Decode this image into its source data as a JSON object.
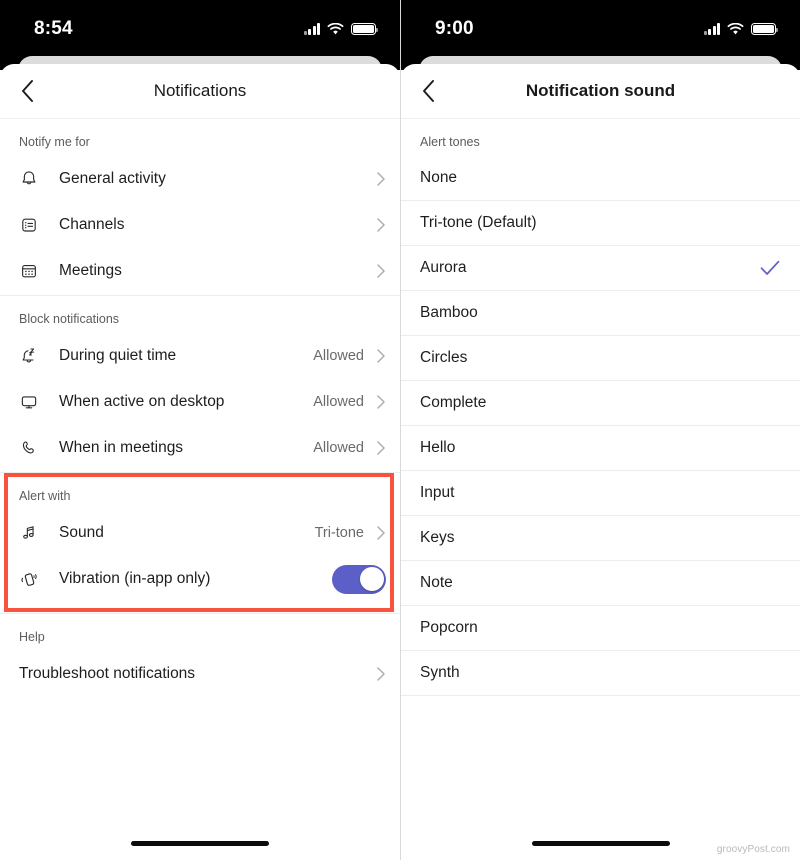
{
  "left": {
    "status": {
      "time": "8:54",
      "signal_icon": "cellular-signal-icon",
      "wifi_icon": "wifi-icon",
      "battery_icon": "battery-icon"
    },
    "nav": {
      "back_icon": "chevron-left-icon",
      "title": "Notifications"
    },
    "sections": [
      {
        "header": "Notify me for",
        "highlight": false,
        "rows": [
          {
            "icon": "bell-icon",
            "label": "General activity",
            "value": "",
            "control": "chevron"
          },
          {
            "icon": "channel-icon",
            "label": "Channels",
            "value": "",
            "control": "chevron"
          },
          {
            "icon": "calendar-icon",
            "label": "Meetings",
            "value": "",
            "control": "chevron"
          }
        ]
      },
      {
        "header": "Block notifications",
        "highlight": false,
        "rows": [
          {
            "icon": "bell-quiet-time-icon",
            "label": "During quiet time",
            "value": "Allowed",
            "control": "chevron"
          },
          {
            "icon": "desktop-monitor-icon",
            "label": "When active on desktop",
            "value": "Allowed",
            "control": "chevron"
          },
          {
            "icon": "phone-call-icon",
            "label": "When in meetings",
            "value": "Allowed",
            "control": "chevron"
          }
        ]
      },
      {
        "header": "Alert with",
        "highlight": true,
        "rows": [
          {
            "icon": "music-note-icon",
            "label": "Sound",
            "value": "Tri-tone",
            "control": "chevron"
          },
          {
            "icon": "vibration-icon",
            "label": "Vibration (in-app only)",
            "value": "",
            "control": "toggle",
            "toggle_on": true
          }
        ]
      },
      {
        "header": "Help",
        "highlight": false,
        "rows": [
          {
            "icon": "",
            "label": "Troubleshoot notifications",
            "value": "",
            "control": "chevron"
          }
        ]
      }
    ],
    "home_indicator": "home-indicator"
  },
  "right": {
    "status": {
      "time": "9:00",
      "signal_icon": "cellular-signal-icon",
      "wifi_icon": "wifi-icon",
      "battery_icon": "battery-icon"
    },
    "nav": {
      "back_icon": "chevron-left-icon",
      "title": "Notification sound"
    },
    "list_header": "Alert tones",
    "tones": [
      {
        "label": "None",
        "selected": false
      },
      {
        "label": "Tri-tone (Default)",
        "selected": false
      },
      {
        "label": "Aurora",
        "selected": true
      },
      {
        "label": "Bamboo",
        "selected": false
      },
      {
        "label": "Circles",
        "selected": false
      },
      {
        "label": "Complete",
        "selected": false
      },
      {
        "label": "Hello",
        "selected": false
      },
      {
        "label": "Input",
        "selected": false
      },
      {
        "label": "Keys",
        "selected": false
      },
      {
        "label": "Note",
        "selected": false
      },
      {
        "label": "Popcorn",
        "selected": false
      },
      {
        "label": "Synth",
        "selected": false
      }
    ],
    "selected_check_icon": "checkmark-icon",
    "watermark": "groovyPost.com",
    "home_indicator": "home-indicator"
  },
  "colors": {
    "accent_purple": "#5b5fc7",
    "highlight_red": "#f9533f",
    "text_primary": "#1e1e1e",
    "text_secondary": "#6a6a6a",
    "divider": "#ececec"
  }
}
